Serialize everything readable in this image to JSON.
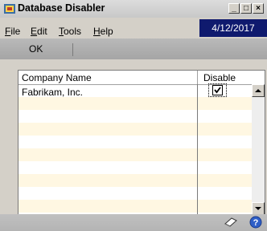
{
  "window": {
    "title": "Database Disabler",
    "controls": {
      "minimize": "_",
      "maximize": "□",
      "close": "×"
    }
  },
  "menu": [
    {
      "label": "File",
      "key": "F"
    },
    {
      "label": "Edit",
      "key": "E"
    },
    {
      "label": "Tools",
      "key": "T"
    },
    {
      "label": "Help",
      "key": "H"
    }
  ],
  "date_display": "4/12/2017",
  "toolbar": {
    "ok_label": "OK"
  },
  "table": {
    "columns": [
      "Company Name",
      "Disable"
    ],
    "rows": [
      {
        "company": "Fabrikam, Inc.",
        "disabled": true
      }
    ]
  },
  "icons": [
    "app-icon",
    "notes-icon",
    "help-icon"
  ]
}
